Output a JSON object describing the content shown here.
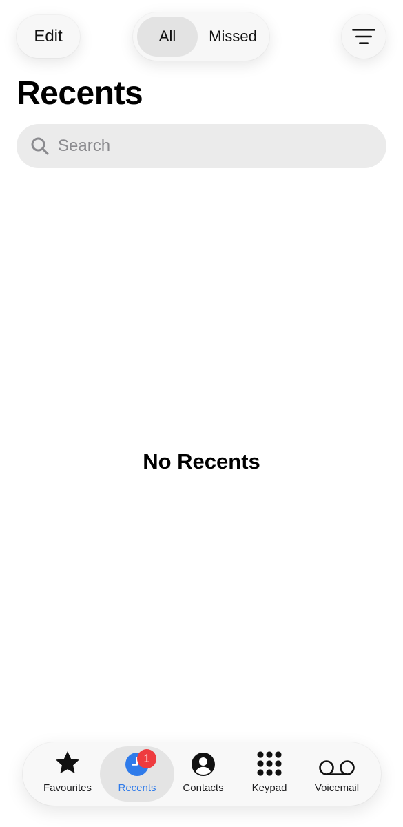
{
  "header": {
    "edit_label": "Edit",
    "segments": [
      {
        "label": "All",
        "selected": true
      },
      {
        "label": "Missed",
        "selected": false
      }
    ],
    "filter_icon": "filter-lines-icon"
  },
  "title": "Recents",
  "search": {
    "placeholder": "Search",
    "value": ""
  },
  "empty_state": "No Recents",
  "tabbar": {
    "active_color": "#2f7bea",
    "badge_color": "#ee3b3f",
    "items": [
      {
        "label": "Favourites",
        "icon": "star-icon"
      },
      {
        "label": "Recents",
        "icon": "clock-icon",
        "badge": "1",
        "active": true
      },
      {
        "label": "Contacts",
        "icon": "person-circle-icon"
      },
      {
        "label": "Keypad",
        "icon": "keypad-icon"
      },
      {
        "label": "Voicemail",
        "icon": "voicemail-icon"
      }
    ]
  }
}
